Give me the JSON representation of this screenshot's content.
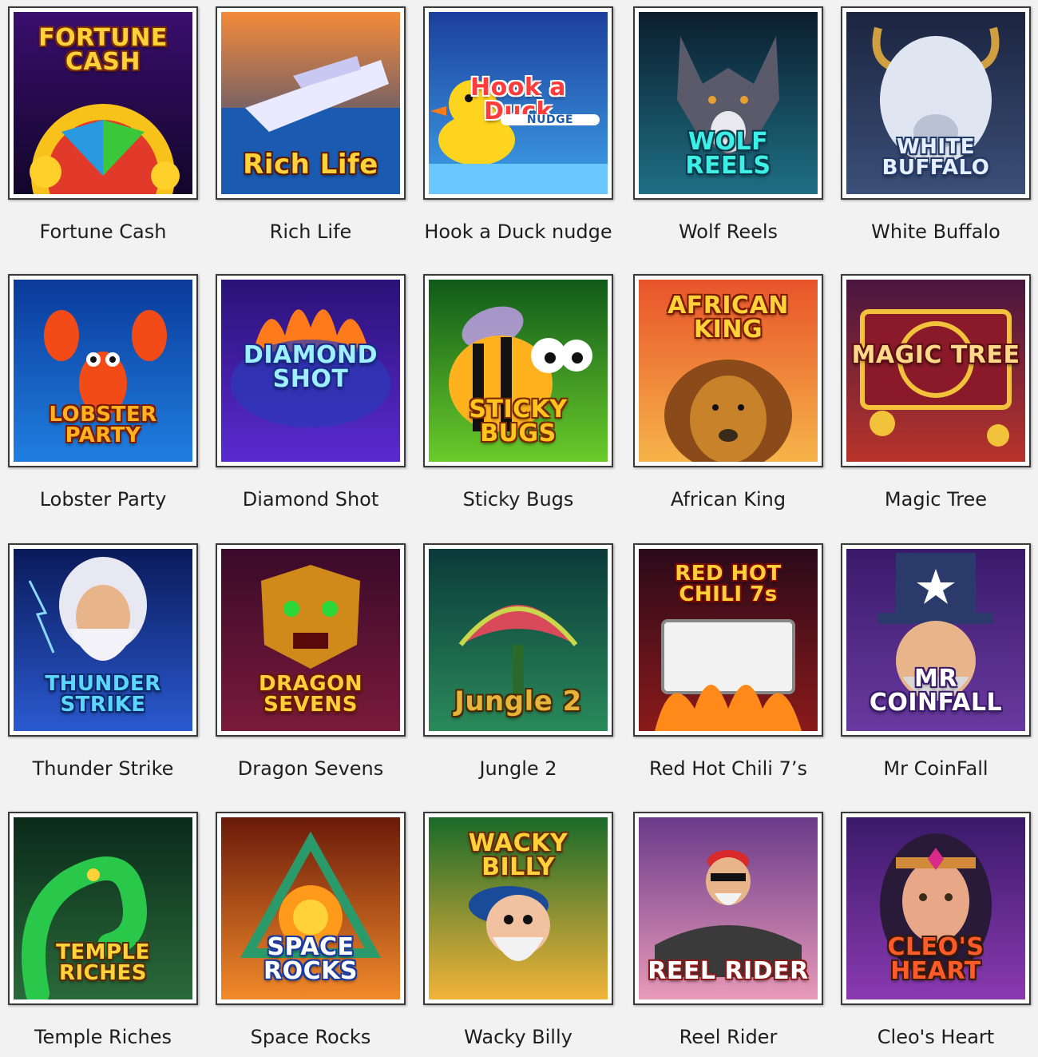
{
  "games": [
    {
      "title": "Fortune Cash",
      "logo": "FORTUNE CASH",
      "bg": [
        "#3a0e6e",
        "#12062a"
      ],
      "accent": "#f7c21a",
      "logo_color": "#ffd23a",
      "stroke": "#7a2a00",
      "icon": "fortune-wheel-icon",
      "logo_pos": "top"
    },
    {
      "title": "Rich Life",
      "logo": "Rich Life",
      "bg": [
        "#f48a3a",
        "#0e3f8a"
      ],
      "accent": "#e9e9ff",
      "logo_color": "#ffd23a",
      "stroke": "#5a1a00",
      "icon": "yacht-icon",
      "logo_pos": "bottom"
    },
    {
      "title": "Hook a Duck nudge",
      "logo": "Hook a Duck",
      "logo_sub": "NUDGE",
      "bg": [
        "#1b3f9c",
        "#3fa2ea"
      ],
      "accent": "#ffd41e",
      "logo_color": "#ff3b3b",
      "stroke": "#ffffff",
      "icon": "rubber-duck-icon",
      "logo_pos": "middle"
    },
    {
      "title": "Wolf Reels",
      "logo": "WOLF REELS",
      "bg": [
        "#0b1e2e",
        "#1e6f84"
      ],
      "accent": "#5a5a6a",
      "logo_color": "#3cf0e6",
      "stroke": "#063a4a",
      "icon": "wolf-icon",
      "logo_pos": "bottom"
    },
    {
      "title": "White Buffalo",
      "logo": "WHITE BUFFALO",
      "bg": [
        "#1c2540",
        "#3b4f78"
      ],
      "accent": "#dfe6f2",
      "logo_color": "#e6efff",
      "stroke": "#243a66",
      "icon": "buffalo-icon",
      "logo_pos": "bottom"
    },
    {
      "title": "Lobster Party",
      "logo": "LOBSTER PARTY",
      "bg": [
        "#0b3a9a",
        "#1f7fe0"
      ],
      "accent": "#f24b18",
      "logo_color": "#ffb21e",
      "stroke": "#7a1a00",
      "icon": "lobster-icon",
      "logo_pos": "bottom"
    },
    {
      "title": "Diamond Shot",
      "logo": "DIAMOND SHOT",
      "bg": [
        "#2a1277",
        "#5a2ad0"
      ],
      "accent": "#ff7a1a",
      "logo_color": "#9ff0ff",
      "stroke": "#1a2a8a",
      "icon": "flame-icon",
      "logo_pos": "middle"
    },
    {
      "title": "Sticky Bugs",
      "logo": "STICKY BUGS",
      "bg": [
        "#0f5a1a",
        "#6acb2a"
      ],
      "accent": "#ffb21e",
      "logo_color": "#ffc41e",
      "stroke": "#7a2a00",
      "icon": "bee-icon",
      "logo_pos": "bottom"
    },
    {
      "title": "African King",
      "logo": "AFRICAN KING",
      "bg": [
        "#e8542a",
        "#f6b44a"
      ],
      "accent": "#c8822a",
      "logo_color": "#ffd23a",
      "stroke": "#7a1a00",
      "icon": "lion-icon",
      "logo_pos": "top"
    },
    {
      "title": "Magic Tree",
      "logo": "MAGIC TREE",
      "bg": [
        "#4a1640",
        "#b8342a"
      ],
      "accent": "#f2c23a",
      "logo_color": "#ffd98a",
      "stroke": "#5a1010",
      "icon": "coin-icon",
      "logo_pos": "middle"
    },
    {
      "title": "Thunder Strike",
      "logo": "THUNDER STRIKE",
      "bg": [
        "#0a1a5a",
        "#2a5ad0"
      ],
      "accent": "#e8e8f2",
      "logo_color": "#5ad6ff",
      "stroke": "#0a2a6a",
      "icon": "zeus-icon",
      "logo_pos": "bottom"
    },
    {
      "title": "Dragon Sevens",
      "logo": "DRAGON SEVENS",
      "bg": [
        "#3a0a2a",
        "#7a1a3a"
      ],
      "accent": "#d08a1a",
      "logo_color": "#ffcf3a",
      "stroke": "#6a1a00",
      "icon": "dragon-mask-icon",
      "logo_pos": "bottom"
    },
    {
      "title": "Jungle 2",
      "logo": "Jungle 2",
      "bg": [
        "#0a3a3a",
        "#2a8a5a"
      ],
      "accent": "#c8d84a",
      "logo_color": "#e6b43a",
      "stroke": "#4a2a00",
      "icon": "venus-flytrap-icon",
      "logo_pos": "bottom"
    },
    {
      "title": "Red Hot Chili 7’s",
      "logo": "RED HOT CHILI 7s",
      "bg": [
        "#2a0a1a",
        "#8a1a1a"
      ],
      "accent": "#ff8a1a",
      "logo_color": "#ffcf3a",
      "stroke": "#7a0a00",
      "icon": "slot-reels-icon",
      "logo_pos": "top"
    },
    {
      "title": "Mr CoinFall",
      "logo": "MR COINFALL",
      "bg": [
        "#3a1a6a",
        "#6a3aa0"
      ],
      "accent": "#2a3a6a",
      "logo_color": "#ffffff",
      "stroke": "#3a1a6a",
      "icon": "uncle-sam-hat-icon",
      "logo_pos": "bottom"
    },
    {
      "title": "Temple Riches",
      "logo": "TEMPLE RICHES",
      "bg": [
        "#0a2a1a",
        "#2a6a3a"
      ],
      "accent": "#2ac84a",
      "logo_color": "#ffd23a",
      "stroke": "#5a2a00",
      "icon": "snake-icon",
      "logo_pos": "bottom"
    },
    {
      "title": "Space Rocks",
      "logo": "SPACE ROCKS",
      "bg": [
        "#6a1a0a",
        "#f28a2a"
      ],
      "accent": "#2a9a6a",
      "logo_color": "#ffffff",
      "stroke": "#1a3aa0",
      "icon": "gem-icon",
      "logo_pos": "bottom"
    },
    {
      "title": "Wacky Billy",
      "logo": "WACKY BILLY",
      "bg": [
        "#1a6a2a",
        "#f2b43a"
      ],
      "accent": "#1a4a9a",
      "logo_color": "#ffd23a",
      "stroke": "#6a2a00",
      "icon": "old-man-icon",
      "logo_pos": "top"
    },
    {
      "title": "Reel Rider",
      "logo": "REEL RIDER",
      "bg": [
        "#6a3a8a",
        "#e89ab8"
      ],
      "accent": "#3a3a3a",
      "logo_color": "#ffffff",
      "stroke": "#8a1a1a",
      "icon": "biker-icon",
      "logo_pos": "bottom"
    },
    {
      "title": "Cleo's Heart",
      "logo": "CLEO'S HEART",
      "bg": [
        "#3a1a6a",
        "#8a3ab0"
      ],
      "accent": "#d08a3a",
      "logo_color": "#ff5a2a",
      "stroke": "#3a1a00",
      "icon": "cleopatra-icon",
      "logo_pos": "bottom"
    }
  ]
}
